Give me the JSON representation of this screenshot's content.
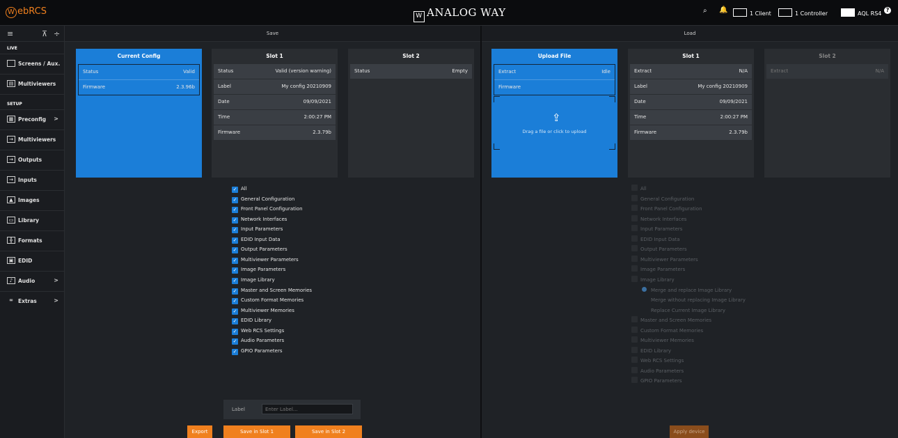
{
  "topbar": {
    "logo_text": "ebRCS",
    "logo_letter": "W",
    "brand": "ANALOG WAY",
    "clients": "1 Client",
    "controllers": "1 Controller",
    "device": "AQL RS4"
  },
  "sidebar": {
    "live_label": "LIVE",
    "setup_label": "SETUP",
    "live_items": [
      {
        "label": "Screens / Aux.",
        "icon": "screen-icon"
      },
      {
        "label": "Multiviewers",
        "icon": "multiviewer-icon"
      }
    ],
    "setup_items": [
      {
        "label": "Preconfig",
        "icon": "preconfig-icon",
        "arrow": ">"
      },
      {
        "label": "Multiviewers",
        "icon": "multiviewer-icon"
      },
      {
        "label": "Outputs",
        "icon": "output-icon"
      },
      {
        "label": "Inputs",
        "icon": "input-icon"
      },
      {
        "label": "Images",
        "icon": "image-icon"
      },
      {
        "label": "Library",
        "icon": "library-icon"
      },
      {
        "label": "Formats",
        "icon": "format-icon"
      },
      {
        "label": "EDID",
        "icon": "edid-icon"
      },
      {
        "label": "Audio",
        "icon": "audio-icon",
        "arrow": ">"
      },
      {
        "label": "Extras",
        "icon": "extras-icon",
        "arrow": ">"
      }
    ]
  },
  "save": {
    "title": "Save",
    "current": {
      "title": "Current Config",
      "status_key": "Status",
      "status_val": "Valid",
      "fw_key": "Firmware",
      "fw_val": "2.3.96b"
    },
    "slot1": {
      "title": "Slot 1",
      "rows": [
        {
          "k": "Status",
          "v": "Valid (version warning)"
        },
        {
          "k": "Label",
          "v": "My config 20210909"
        },
        {
          "k": "Date",
          "v": "09/09/2021"
        },
        {
          "k": "Time",
          "v": "2:00:27 PM"
        },
        {
          "k": "Firmware",
          "v": "2.3.79b"
        }
      ]
    },
    "slot2": {
      "title": "Slot 2",
      "rows": [
        {
          "k": "Status",
          "v": "Empty"
        }
      ]
    },
    "checks": [
      "All",
      "General Configuration",
      "Front Panel Configuration",
      "Network Interfaces",
      "Input Parameters",
      "EDID Input Data",
      "Output Parameters",
      "Multiviewer Parameters",
      "Image Parameters",
      "Image Library",
      "Master and Screen Memories",
      "Custom Format Memories",
      "Multiviewer Memories",
      "EDID Library",
      "Web RCS Settings",
      "Audio Parameters",
      "GPIO Parameters"
    ],
    "label_field": {
      "label": "Label",
      "placeholder": "Enter Label..."
    },
    "buttons": {
      "export": "Export",
      "slot1": "Save in Slot 1",
      "slot2": "Save in Slot 2"
    }
  },
  "load": {
    "title": "Load",
    "upload": {
      "title": "Upload File",
      "extract_key": "Extract",
      "extract_val": "Idle",
      "fw_key": "Firmware",
      "drop_text": "Drag a file or click to upload"
    },
    "slot1": {
      "title": "Slot 1",
      "rows": [
        {
          "k": "Extract",
          "v": "N/A"
        },
        {
          "k": "Label",
          "v": "My config 20210909"
        },
        {
          "k": "Date",
          "v": "09/09/2021"
        },
        {
          "k": "Time",
          "v": "2:00:27 PM"
        },
        {
          "k": "Firmware",
          "v": "2.3.79b"
        }
      ]
    },
    "slot2": {
      "title": "Slot 2",
      "rows": [
        {
          "k": "Extract",
          "v": "N/A"
        }
      ]
    },
    "checks": [
      "All",
      "General Configuration",
      "Front Panel Configuration",
      "Network Interfaces",
      "Input Parameters",
      "EDID Input Data",
      "Output Parameters",
      "Multiviewer Parameters",
      "Image Parameters",
      "Image Library"
    ],
    "radios": [
      "Merge and replace Image Library",
      "Merge without replacing Image Library",
      "Replace Current Image Library"
    ],
    "checks2": [
      "Master and Screen Memories",
      "Custom Format Memories",
      "Multiviewer Memories",
      "EDID Library",
      "Web RCS Settings",
      "Audio Parameters",
      "GPIO Parameters"
    ],
    "apply": "Apply device"
  }
}
